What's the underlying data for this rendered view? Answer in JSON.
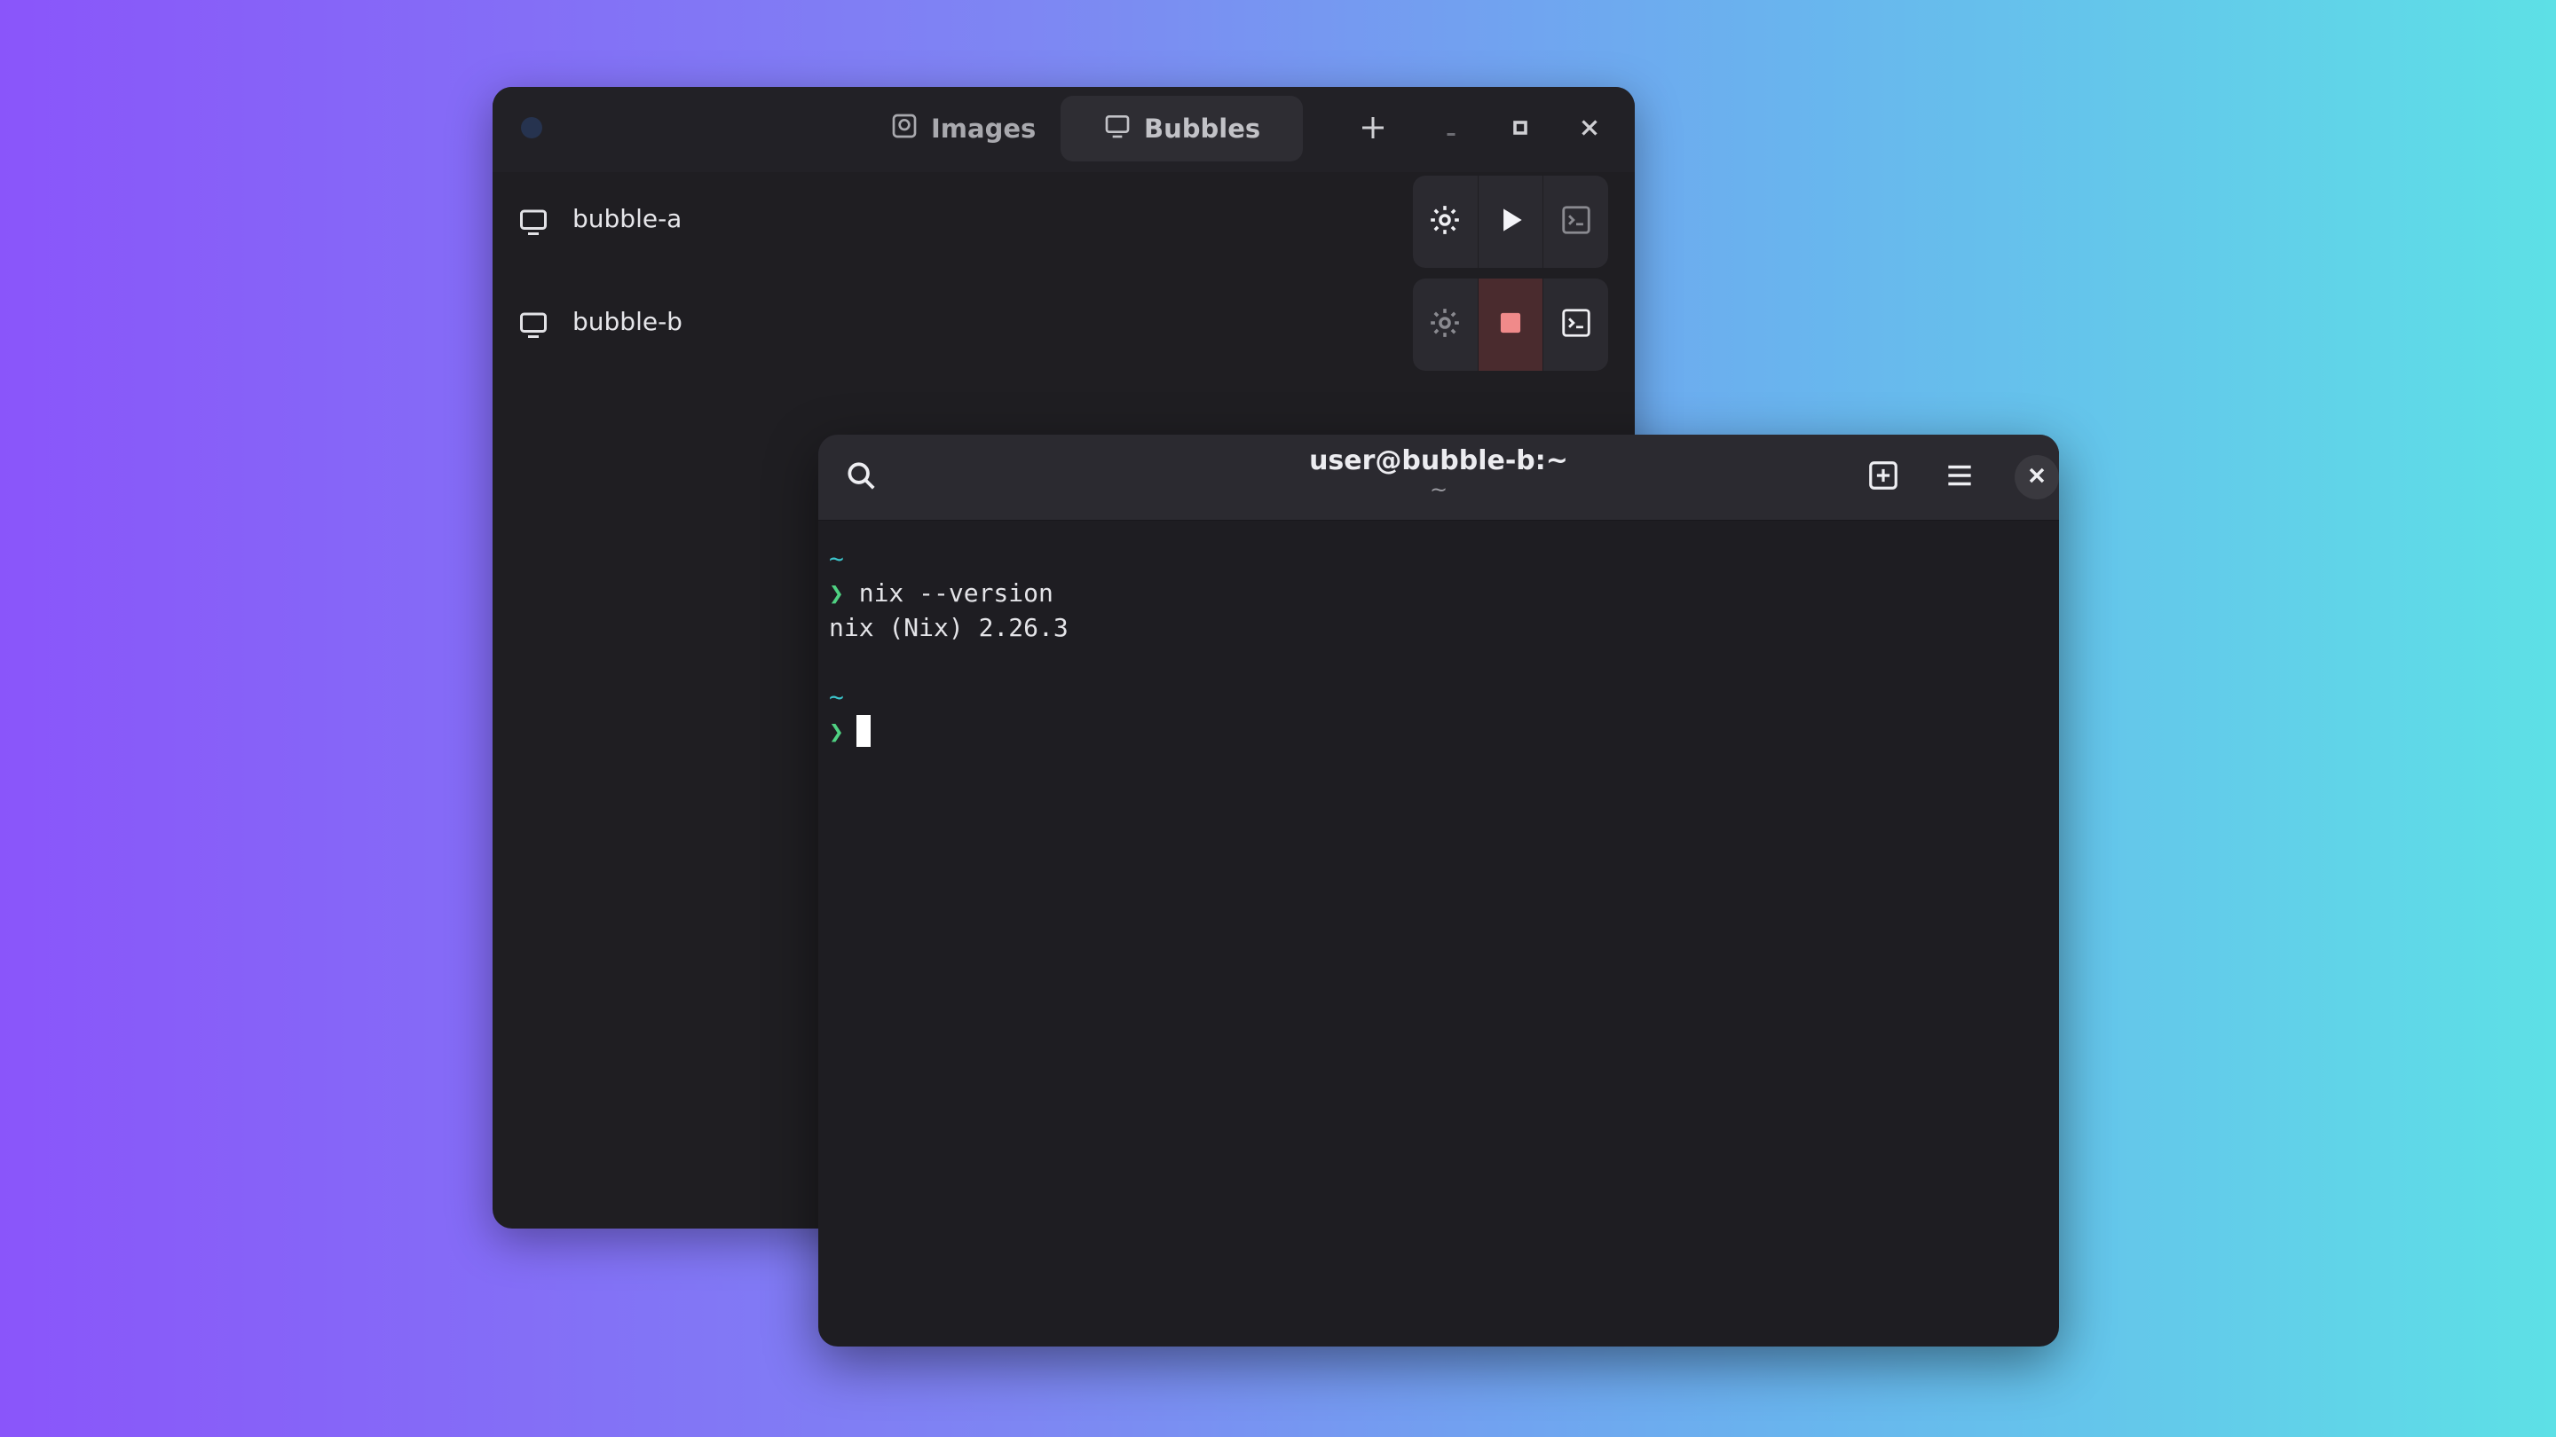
{
  "manager": {
    "tabs": [
      {
        "label": "Images",
        "icon": "image-icon"
      },
      {
        "label": "Bubbles",
        "icon": "monitor-icon"
      }
    ],
    "header_buttons": [
      "add-icon",
      "minimize-icon",
      "maximize-icon",
      "close-icon"
    ],
    "bubbles": [
      {
        "name": "bubble-a",
        "state": "stopped",
        "actions": [
          "settings",
          "start",
          "terminal"
        ]
      },
      {
        "name": "bubble-b",
        "state": "running",
        "actions": [
          "settings",
          "stop",
          "terminal"
        ]
      }
    ],
    "colors": {
      "stop": "#f08a8a",
      "background": "#1f1e22"
    }
  },
  "terminal": {
    "title": "user@bubble-b:~",
    "subtitle": "~",
    "lines": [
      {
        "cwd": "~"
      },
      {
        "prompt": "❯",
        "command": "nix --version"
      },
      {
        "output": "nix (Nix) 2.26.3"
      },
      {
        "cwd": "~"
      },
      {
        "prompt": "❯",
        "command": ""
      }
    ],
    "colors": {
      "cwd": "#3cc5cc",
      "prompt": "#4fd182"
    }
  }
}
